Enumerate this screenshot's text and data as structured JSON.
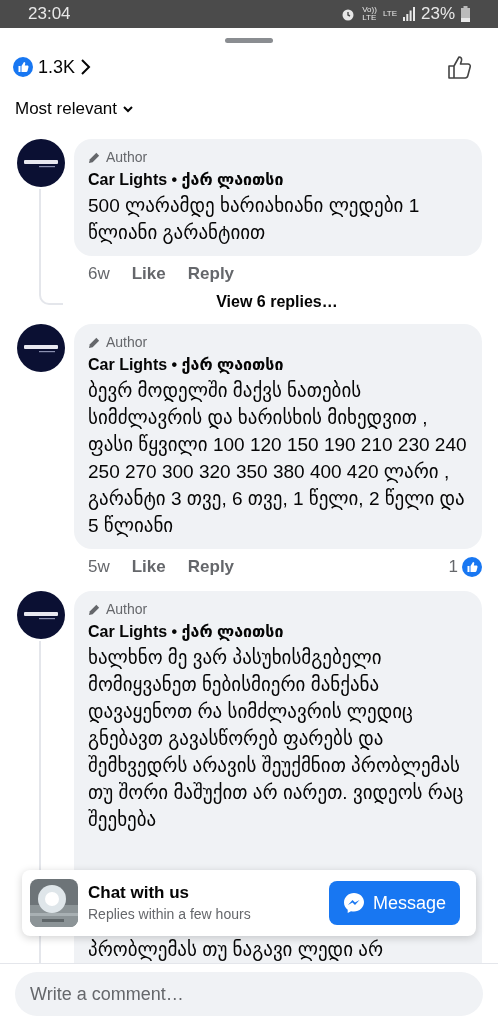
{
  "status_bar": {
    "time": "23:04",
    "volte": [
      "Vo))",
      "LTE"
    ],
    "network": "LTE",
    "battery": "23%"
  },
  "reactions": {
    "count": "1.3K"
  },
  "sort": {
    "label": "Most relevant"
  },
  "comments": [
    {
      "badge": "Author",
      "name": "Car Lights • ქარ ლაითსი",
      "text": "500 ლარამდე ხარიახიანი ლედები 1 წლიანი გარანტიით",
      "time": "6w",
      "like": "Like",
      "reply": "Reply",
      "view_replies": "View 6 replies…"
    },
    {
      "badge": "Author",
      "name": "Car Lights • ქარ ლაითსი",
      "text": "ბევრ მოდელში მაქვს ნათების სიმძლავრის და ხარისხის მიხედვით , ფასი წყვილი  100 120 150 190 210 230 240 250 270 300 320 350 380 400 420 ლარი , გარანტი 3 თვე, 6 თვე, 1 წელი, 2 წელი და 5 წლიანი",
      "time": "5w",
      "like": "Like",
      "reply": "Reply",
      "reaction_count": "1"
    },
    {
      "badge": "Author",
      "name": "Car Lights • ქარ ლაითსი",
      "text": "ხალხნო მე ვარ პასუხისმგებელი მომიყვანეთ ნებისმიერი მანქანა დავაყენოთ რა სიმძლავრის ლედიც გნებავთ გავასწორებ ფარებს და შემხვედრს არავის შეუქმნით პრობლემას თუ შორი მაშუქით არ იარეთ.  ვიდეოს რაც შეეხება",
      "continuation": "პრობლემას თუ ნაგავი ლედი არ",
      "thread": true
    }
  ],
  "chat_prompt": {
    "title": "Chat with us",
    "subtitle": "Replies within a few hours",
    "button": "Message"
  },
  "composer": {
    "placeholder": "Write a comment…"
  }
}
